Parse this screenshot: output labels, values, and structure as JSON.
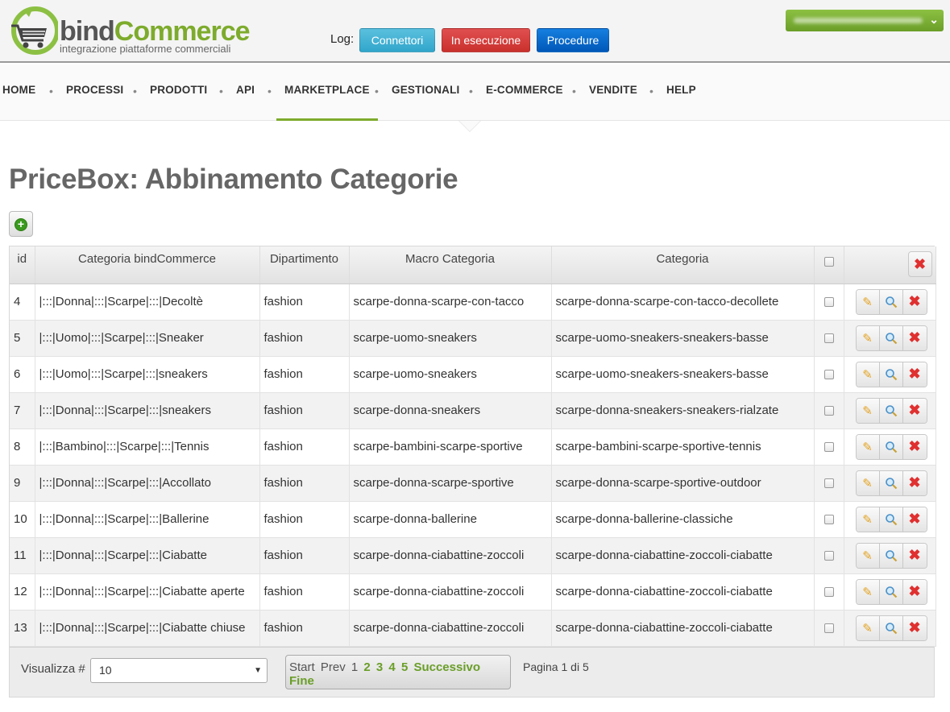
{
  "header": {
    "logo_name_a": "bind",
    "logo_name_b": "Commerce",
    "logo_tagline": "integrazione piattaforme commerciali",
    "log_label": "Log:",
    "buttons": {
      "connectors": "Connettori",
      "running": "In esecuzione",
      "procedures": "Procedure"
    }
  },
  "nav": {
    "items": [
      "HOME",
      "PROCESSI",
      "PRODOTTI",
      "API",
      "MARKETPLACE",
      "GESTIONALI",
      "E-COMMERCE",
      "VENDITE",
      "HELP"
    ],
    "active": "MARKETPLACE"
  },
  "page": {
    "title": "PriceBox: Abbinamento Categorie"
  },
  "table": {
    "columns": [
      "id",
      "Categoria bindCommerce",
      "Dipartimento",
      "Macro Categoria",
      "Categoria"
    ],
    "rows": [
      [
        "4",
        "|:::|Donna|:::|Scarpe|:::|Decoltè",
        "fashion",
        "scarpe-donna-scarpe-con-tacco",
        "scarpe-donna-scarpe-con-tacco-decollete"
      ],
      [
        "5",
        "|:::|Uomo|:::|Scarpe|:::|Sneaker",
        "fashion",
        "scarpe-uomo-sneakers",
        "scarpe-uomo-sneakers-sneakers-basse"
      ],
      [
        "6",
        "|:::|Uomo|:::|Scarpe|:::|sneakers",
        "fashion",
        "scarpe-uomo-sneakers",
        "scarpe-uomo-sneakers-sneakers-basse"
      ],
      [
        "7",
        "|:::|Donna|:::|Scarpe|:::|sneakers",
        "fashion",
        "scarpe-donna-sneakers",
        "scarpe-donna-sneakers-sneakers-rialzate"
      ],
      [
        "8",
        "|:::|Bambino|:::|Scarpe|:::|Tennis",
        "fashion",
        "scarpe-bambini-scarpe-sportive",
        "scarpe-bambini-scarpe-sportive-tennis"
      ],
      [
        "9",
        "|:::|Donna|:::|Scarpe|:::|Accollato",
        "fashion",
        "scarpe-donna-scarpe-sportive",
        "scarpe-donna-scarpe-sportive-outdoor"
      ],
      [
        "10",
        "|:::|Donna|:::|Scarpe|:::|Ballerine",
        "fashion",
        "scarpe-donna-ballerine",
        "scarpe-donna-ballerine-classiche"
      ],
      [
        "11",
        "|:::|Donna|:::|Scarpe|:::|Ciabatte",
        "fashion",
        "scarpe-donna-ciabattine-zoccoli",
        "scarpe-donna-ciabattine-zoccoli-ciabatte"
      ],
      [
        "12",
        "|:::|Donna|:::|Scarpe|:::|Ciabatte aperte",
        "fashion",
        "scarpe-donna-ciabattine-zoccoli",
        "scarpe-donna-ciabattine-zoccoli-ciabatte"
      ],
      [
        "13",
        "|:::|Donna|:::|Scarpe|:::|Ciabatte chiuse",
        "fashion",
        "scarpe-donna-ciabattine-zoccoli",
        "scarpe-donna-ciabattine-zoccoli-ciabatte"
      ]
    ]
  },
  "footer": {
    "show_label": "Visualizza #",
    "show_value": "10",
    "pager": {
      "start": "Start",
      "prev": "Prev",
      "pages": [
        "1",
        "2",
        "3",
        "4",
        "5"
      ],
      "next": "Successivo",
      "end": "Fine"
    },
    "page_info": "Pagina 1 di 5"
  },
  "icons": {
    "add": "plus-circle-icon",
    "edit": "pencil-icon",
    "view": "magnifier-icon",
    "delete": "x-icon",
    "user_menu": "chevron-down-icon"
  },
  "colors": {
    "brand_green": "#7dab2c",
    "connectors": "#5bc0de",
    "running": "#d9534f",
    "procedures": "#0a6fd6"
  }
}
